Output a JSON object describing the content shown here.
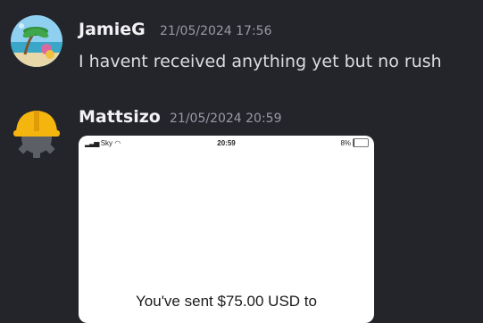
{
  "messages": [
    {
      "username": "JamieG",
      "timestamp": "21/05/2024 17:56",
      "text": "I havent received anything yet but no rush"
    },
    {
      "username": "Mattsizo",
      "timestamp": "21/05/2024 20:59",
      "attachment": {
        "status_bar": {
          "carrier": "Sky",
          "time": "20:59",
          "battery": "8%",
          "battery_level": 0.08
        },
        "body_text": "You've sent $75.00 USD to"
      }
    }
  ]
}
